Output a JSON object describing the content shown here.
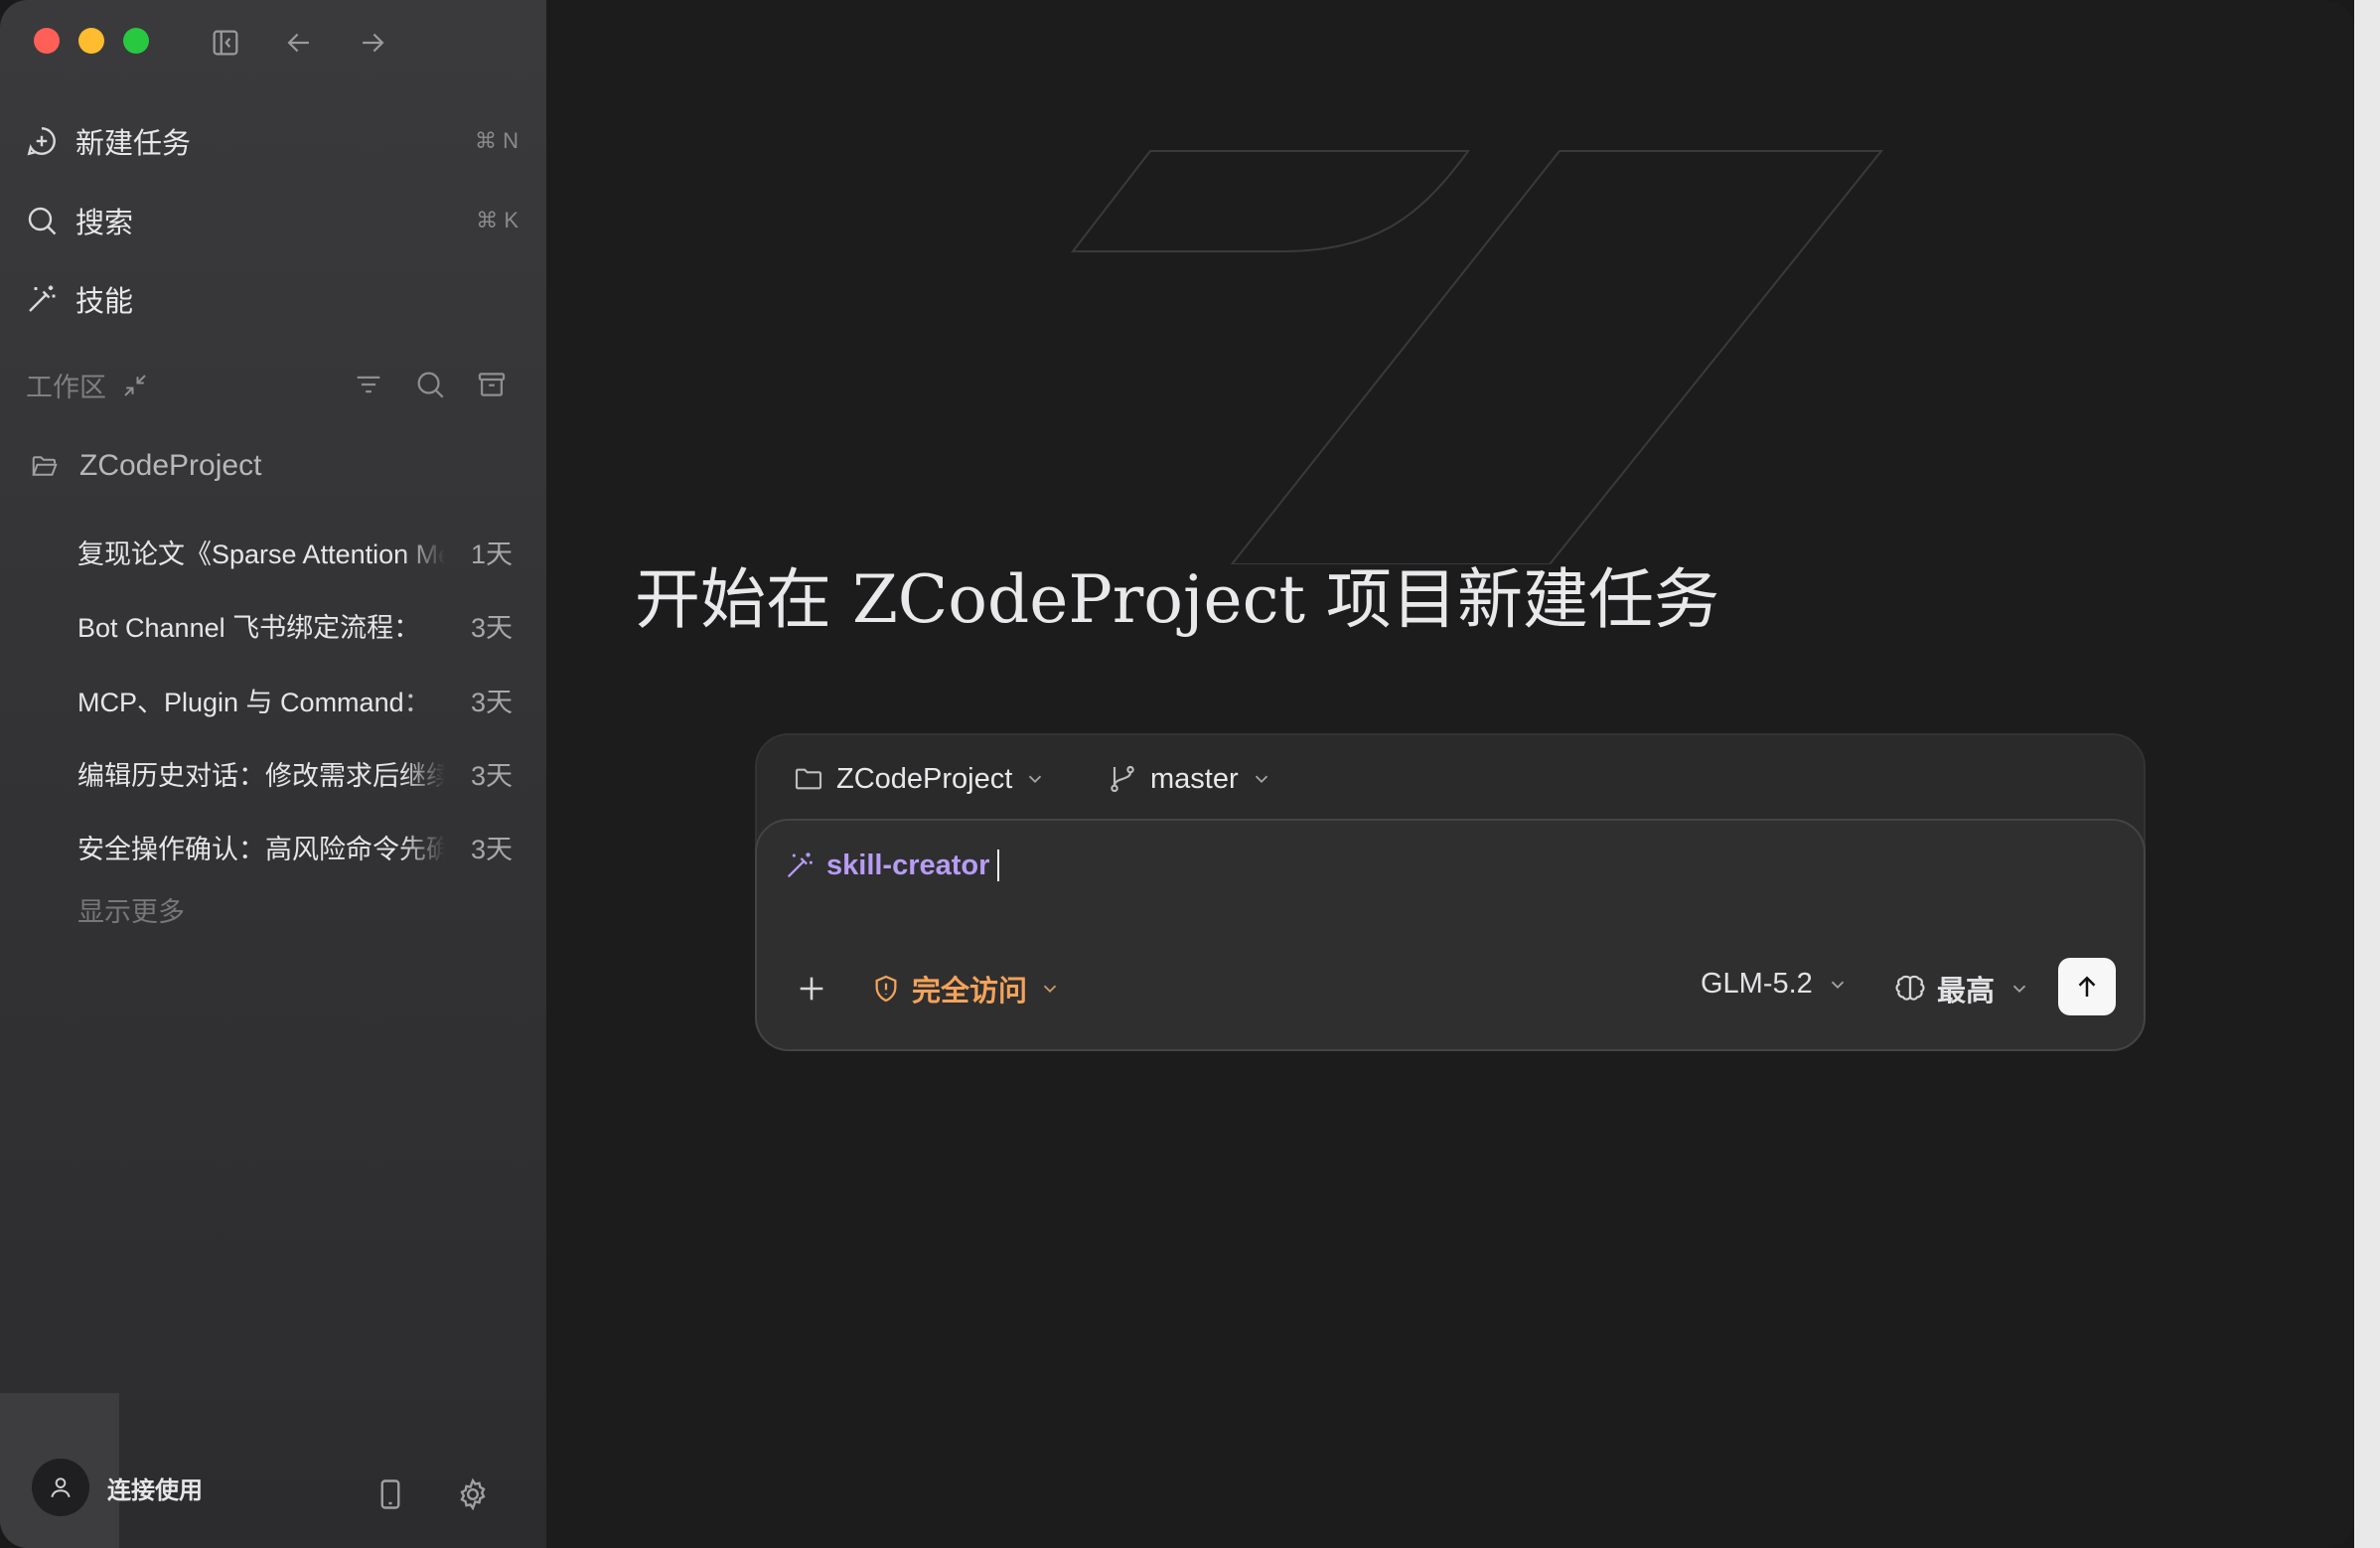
{
  "window": {
    "traffic_lights": {
      "close": "#fe5f57",
      "minimize": "#febc2e",
      "maximize": "#28c840"
    }
  },
  "sidebar": {
    "nav": [
      {
        "label": "新建任务",
        "shortcut": "⌘ N",
        "icon": "new-task-icon"
      },
      {
        "label": "搜索",
        "shortcut": "⌘ K",
        "icon": "search-icon"
      },
      {
        "label": "技能",
        "shortcut": "",
        "icon": "magic-wand-icon"
      }
    ],
    "workspace_label": "工作区",
    "project": "ZCodeProject",
    "tasks": [
      {
        "title": "复现论文《Sparse Attention Mechanisms》",
        "age": "1天"
      },
      {
        "title": "Bot Channel 飞书绑定流程：",
        "age": "3天"
      },
      {
        "title": "MCP、Plugin 与 Command：",
        "age": "3天"
      },
      {
        "title": "编辑历史对话：修改需求后继续",
        "age": "3天"
      },
      {
        "title": "安全操作确认：高风险命令先确认",
        "age": "3天"
      }
    ],
    "show_more": "显示更多",
    "user_label": "连接使用"
  },
  "main": {
    "heading": "开始在 ZCodeProject 项目新建任务",
    "composer": {
      "project_selector": "ZCodeProject",
      "branch_selector": "master",
      "skill_tag": "skill-creator",
      "access_mode": "完全访问",
      "model": "GLM-5.2",
      "thinking_level": "最高"
    }
  },
  "colors": {
    "accent_skill": "#b79cf4",
    "accent_access": "#f3a35a",
    "sidebar_bg": "#353537",
    "main_bg": "#1c1c1c"
  }
}
